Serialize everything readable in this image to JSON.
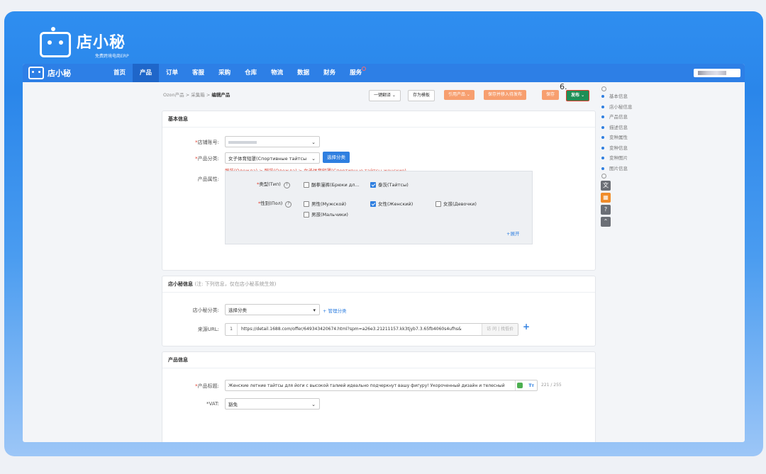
{
  "brand": {
    "name": "店小秘",
    "tagline": "免费跨境电商ERP"
  },
  "nav": {
    "items": [
      {
        "label": "首页",
        "active": false
      },
      {
        "label": "产品",
        "active": true
      },
      {
        "label": "订单",
        "active": false
      },
      {
        "label": "客服",
        "active": false
      },
      {
        "label": "采购",
        "active": false
      },
      {
        "label": "仓库",
        "active": false
      },
      {
        "label": "物流",
        "active": false
      },
      {
        "label": "数据",
        "active": false
      },
      {
        "label": "财务",
        "active": false
      },
      {
        "label": "服务",
        "active": false
      }
    ]
  },
  "breadcrumb": {
    "part1": "Ozon产品",
    "sep": ">",
    "part2": "采集箱",
    "current": "编辑产品"
  },
  "toolbar": {
    "translate": "一键翻译",
    "save_template": "存为模板",
    "cite_product": "引用产品",
    "save_join_publish": "保存并移入待发布",
    "save": "保存",
    "publish": "发布",
    "step": "6."
  },
  "basic": {
    "title": "基本信息",
    "shop_label": "店铺账号:",
    "category_label": "产品分类:",
    "category_value": "女子体育短罩(Спортивные тайтсы",
    "choose_category": "选择分类",
    "category_path": "服装(Одежда) > 服装(Одежда) > 女子体育短罩(Спортивные тайтсы женские)",
    "attr_label": "产品属性:",
    "type_label": "类型(Тип)",
    "type_opt1": "酗拳漫裤(Брюки дл...",
    "type_opt2": "泰茨(Тайтсы)",
    "gender_label": "性别(Пол)",
    "gender_opt1": "男性(Мужской)",
    "gender_opt2": "女性(Женский)",
    "gender_opt3": "女孩(Девочки)",
    "gender_opt4": "男孩(Мальчики)",
    "expand": "+展开"
  },
  "dxm": {
    "title": "店小秘信息",
    "note": "(注: 下列信息，仅在店小秘系统生效)",
    "cat_label": "店小秘分类:",
    "cat_value": "选择分类",
    "manage": "+ 管理分类",
    "url_label": "来源URL:",
    "url_index": "1",
    "url_value": "https://detail.1688.com/offer/649343420674.html?spm=a26e3.21211157.kk3tjyb7.3.65fb4060s4ufhs&",
    "url_action": "访 问 | 找低价"
  },
  "product": {
    "title": "产品信息",
    "name_label": "产品标题:",
    "name_value": "Женские летние тайтсы для йоги с высокой талией идеально подчеркнут вашу фигуру! Укороченный дизайн и телесный",
    "name_tt": "Tт",
    "name_count": "221 / 255",
    "vat_label": "*VAT:",
    "vat_value": "豁免"
  },
  "side": {
    "items": [
      "基本信息",
      "店小秘信息",
      "产品信息",
      "描述信息",
      "变种属性",
      "变种信息",
      "变种图片",
      "图片信息"
    ]
  },
  "colors": {
    "nav": "#2d7fe6",
    "accent": "#2f7fe0",
    "orange": "#f79f6f",
    "publish": "#1f8f56",
    "required": "#e03a2a"
  }
}
